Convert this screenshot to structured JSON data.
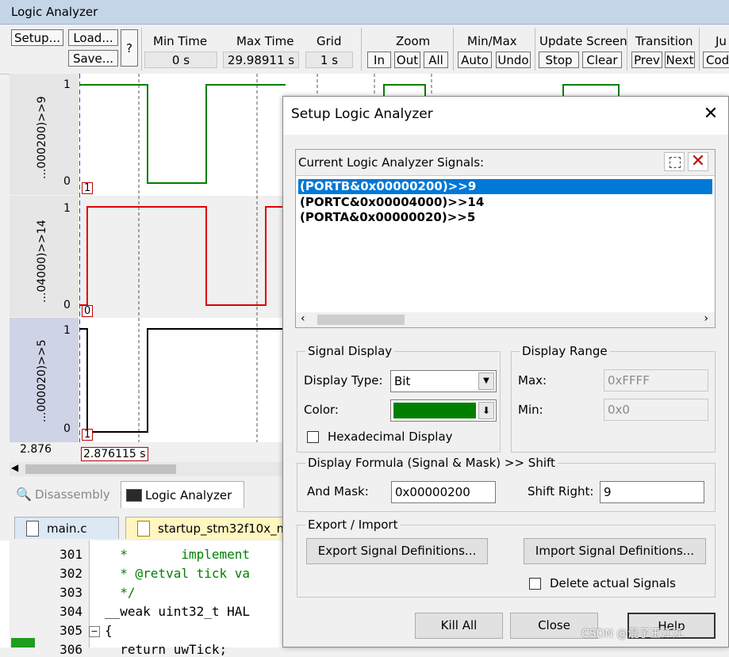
{
  "window": {
    "title": "Logic Analyzer"
  },
  "toolbar": {
    "setup": "Setup...",
    "load": "Load...",
    "save": "Save...",
    "help": "?",
    "min_time_label": "Min Time",
    "min_time_value": "0 s",
    "max_time_label": "Max Time",
    "max_time_value": "29.98911 s",
    "grid_label": "Grid",
    "grid_value": "1 s",
    "zoom_label": "Zoom",
    "zoom_in": "In",
    "zoom_out": "Out",
    "zoom_all": "All",
    "minmax_label": "Min/Max",
    "auto": "Auto",
    "undo": "Undo",
    "update_label": "Update Screen",
    "stop": "Stop",
    "clear": "Clear",
    "transition_label": "Transition",
    "prev": "Prev",
    "next": "Next",
    "jump_label": "Ju",
    "code": "Cod"
  },
  "signals": [
    {
      "label": "...000200)>>9",
      "high": "1",
      "low": "0",
      "marker": "1",
      "color": "#008000"
    },
    {
      "label": "...04000)>>14",
      "high": "1",
      "low": "0",
      "marker": "0",
      "color": "#e00000"
    },
    {
      "label": "...000020)>>5",
      "high": "1",
      "low": "0",
      "marker": "1",
      "color": "#000000"
    }
  ],
  "time_axis": {
    "left_value": "2.876",
    "cursor_value": "2.876115  s"
  },
  "view_tabs": {
    "disassembly": "Disassembly",
    "logic_analyzer": "Logic Analyzer"
  },
  "editor": {
    "tabs": [
      "main.c",
      "startup_stm32f10x_m"
    ],
    "lines": [
      {
        "no": "301",
        "text": "  *       implement"
      },
      {
        "no": "302",
        "text": "  * @retval tick va"
      },
      {
        "no": "303",
        "text": "  */"
      },
      {
        "no": "304",
        "text": "__weak uint32_t HAL"
      },
      {
        "no": "305",
        "text": "{"
      },
      {
        "no": "306",
        "text": "  return uwTick;"
      }
    ]
  },
  "dialog": {
    "title": "Setup Logic Analyzer",
    "signals_label": "Current Logic Analyzer Signals:",
    "signals": [
      "(PORTB&0x00000200)>>9",
      "(PORTC&0x00004000)>>14",
      "(PORTA&0x00000020)>>5"
    ],
    "selected_index": 0,
    "signal_display_legend": "Signal Display",
    "display_type_label": "Display Type:",
    "display_type_value": "Bit",
    "color_label": "Color:",
    "color_value": "#008000",
    "hex_display_label": "Hexadecimal Display",
    "display_range_legend": "Display Range",
    "max_label": "Max:",
    "max_value": "0xFFFF",
    "min_label": "Min:",
    "min_value": "0x0",
    "formula_legend": "Display Formula (Signal & Mask) >> Shift",
    "and_mask_label": "And Mask:",
    "and_mask_value": "0x00000200",
    "shift_right_label": "Shift Right:",
    "shift_right_value": "9",
    "export_import_legend": "Export / Import",
    "export_btn": "Export Signal Definitions...",
    "import_btn": "Import Signal Definitions...",
    "delete_signals_label": "Delete actual Signals",
    "kill_all": "Kill All",
    "close": "Close",
    "help": "Help"
  },
  "watermark": "CSDN @混子王江江"
}
